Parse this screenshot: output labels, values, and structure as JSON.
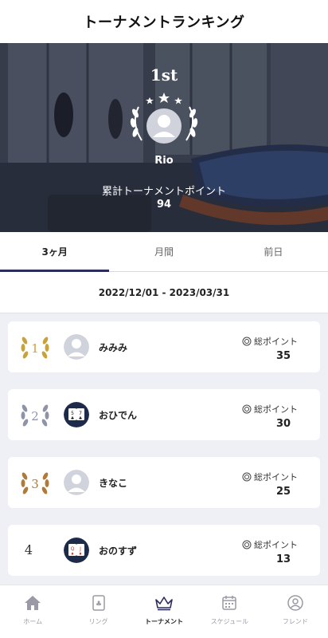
{
  "header": {
    "title": "トーナメントランキング"
  },
  "hero": {
    "rank": "1st",
    "name": "Rio",
    "points_label": "累計トーナメントポイント",
    "points": "94",
    "avatar_icon": "user-avatar-icon"
  },
  "tabs": [
    {
      "label": "3ヶ月",
      "active": true
    },
    {
      "label": "月間",
      "active": false
    },
    {
      "label": "前日",
      "active": false
    }
  ],
  "period": "2022/12/01 - 2023/03/31",
  "rankings": [
    {
      "rank": "1",
      "name": "みみみ",
      "points_label": "総ポイント",
      "points": "35",
      "badge": "gold-laurel",
      "avatar": "default-avatar"
    },
    {
      "rank": "2",
      "name": "おひでん",
      "points_label": "総ポイント",
      "points": "30",
      "badge": "silver-laurel",
      "avatar": "cards-avatar"
    },
    {
      "rank": "3",
      "name": "きなこ",
      "points_label": "総ポイント",
      "points": "25",
      "badge": "bronze-laurel",
      "avatar": "default-avatar"
    },
    {
      "rank": "4",
      "name": "おのすず",
      "points_label": "総ポイント",
      "points": "13",
      "badge": "none",
      "avatar": "qj-cards-avatar"
    }
  ],
  "bottom_nav": [
    {
      "label": "ホーム",
      "icon": "home-icon",
      "active": false
    },
    {
      "label": "リング",
      "icon": "ring-card-icon",
      "active": false
    },
    {
      "label": "トーナメント",
      "icon": "crown-icon",
      "active": true
    },
    {
      "label": "スケジュール",
      "icon": "calendar-icon",
      "active": false
    },
    {
      "label": "フレンド",
      "icon": "friend-icon",
      "active": false
    }
  ],
  "colors": {
    "accent": "#2d2d5a",
    "gold": "#c9a23a",
    "silver": "#8f93a8",
    "bronze": "#b07a3a",
    "list_bg": "#eef0f6"
  }
}
